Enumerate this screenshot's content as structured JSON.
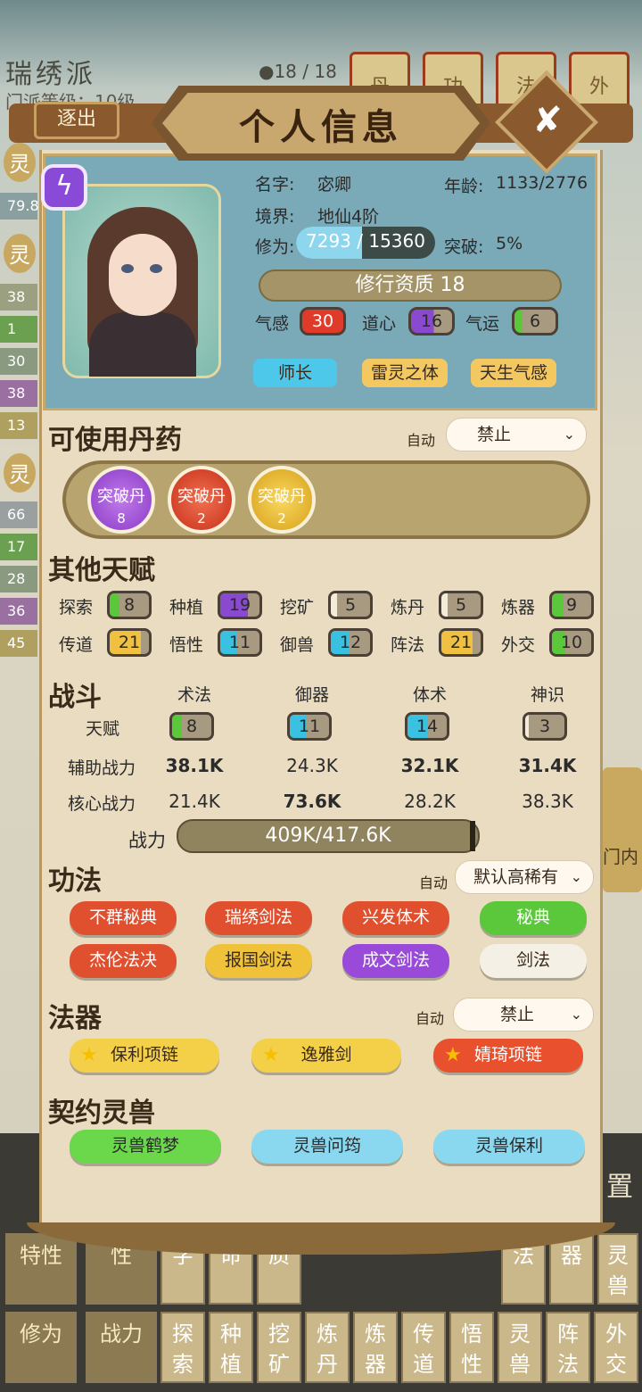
{
  "background": {
    "sect_name": "瑞绣派",
    "sect_level": "门派等级：10级",
    "member_count": "18 / 18",
    "scroll_tabs": [
      "丹",
      "功",
      "法",
      "外"
    ],
    "side_badges": [
      "灵",
      "灵",
      "灵"
    ],
    "side_numbers": [
      "79.8",
      "38",
      "1",
      "30",
      "38",
      "13",
      "66",
      "17",
      "28",
      "36",
      "45"
    ],
    "right_flag_label": "门内",
    "settings_char": "置",
    "grid_row1": [
      "特性",
      "性",
      "字",
      "命",
      "质",
      "",
      "",
      "",
      "",
      "",
      "法",
      "器",
      "灵兽"
    ],
    "grid_row2": [
      "修为",
      "战力",
      "探索",
      "种植",
      "挖矿",
      "炼丹",
      "炼器",
      "传道",
      "悟性",
      "灵兽",
      "阵法",
      "外交"
    ]
  },
  "header": {
    "title": "个人信息",
    "exit_label": "逐出",
    "close_icon": "✘"
  },
  "profile": {
    "name_label": "名字:",
    "name": "宓卿",
    "age_label": "年龄:",
    "age": "1133/2776",
    "realm_label": "境界:",
    "realm": "地仙4阶",
    "cultivation_label": "修为:",
    "cultivation_current": 7293,
    "cultivation_max": 15360,
    "cultivation_text": "7293 / 15360",
    "breakthrough_label": "突破:",
    "breakthrough": "5%",
    "aptitude": "修行资质 18",
    "qigan_label": "气感",
    "qigan": "30",
    "daoxin_label": "道心",
    "daoxin": "16",
    "qiyun_label": "气运",
    "qiyun": "6",
    "tags": [
      "师长",
      "雷灵之体",
      "天生气感"
    ]
  },
  "pills": {
    "title": "可使用丹药",
    "auto_label": "自动",
    "auto_value": "禁止",
    "items": [
      {
        "name": "突破丹",
        "count": "8",
        "color": "#9a4ad0"
      },
      {
        "name": "突破丹",
        "count": "2",
        "color": "#d8401e"
      },
      {
        "name": "突破丹",
        "count": "2",
        "color": "#e8b020"
      }
    ]
  },
  "talents": {
    "title": "其他天赋",
    "items": [
      {
        "label": "探索",
        "value": "8",
        "fill": 0.25,
        "color": "#5ac83a"
      },
      {
        "label": "种植",
        "value": "19",
        "fill": 0.7,
        "color": "#8a4ad0"
      },
      {
        "label": "挖矿",
        "value": "5",
        "fill": 0.15,
        "color": "#f2ecd8"
      },
      {
        "label": "炼丹",
        "value": "5",
        "fill": 0.15,
        "color": "#f2ecd8"
      },
      {
        "label": "炼器",
        "value": "9",
        "fill": 0.3,
        "color": "#5ac83a"
      },
      {
        "label": "传道",
        "value": "21",
        "fill": 0.8,
        "color": "#f0c040"
      },
      {
        "label": "悟性",
        "value": "11",
        "fill": 0.4,
        "color": "#3ac0e0"
      },
      {
        "label": "御兽",
        "value": "12",
        "fill": 0.45,
        "color": "#3ac0e0"
      },
      {
        "label": "阵法",
        "value": "21",
        "fill": 0.8,
        "color": "#f0c040"
      },
      {
        "label": "外交",
        "value": "10",
        "fill": 0.35,
        "color": "#5ac83a"
      }
    ]
  },
  "combat": {
    "title": "战斗",
    "columns": [
      "术法",
      "御器",
      "体术",
      "神识"
    ],
    "talent_label": "天赋",
    "talent_values": [
      {
        "value": "8",
        "fill": 0.25,
        "color": "#5ac83a"
      },
      {
        "value": "11",
        "fill": 0.4,
        "color": "#3ac0e0"
      },
      {
        "value": "14",
        "fill": 0.5,
        "color": "#3ac0e0"
      },
      {
        "value": "3",
        "fill": 0.1,
        "color": "#f2ecd8"
      }
    ],
    "aux_label": "辅助战力",
    "aux_values": [
      "38.1K",
      "24.3K",
      "32.1K",
      "31.4K"
    ],
    "core_label": "核心战力",
    "core_values": [
      "21.4K",
      "73.6K",
      "28.2K",
      "38.3K"
    ],
    "power_label": "战力",
    "power_text": "409K/417.6K",
    "power_current": 409,
    "power_max": 417.6
  },
  "gongfa": {
    "title": "功法",
    "auto_label": "自动",
    "auto_value": "默认高稀有",
    "items": [
      {
        "label": "不群秘典",
        "color": "#e0502e"
      },
      {
        "label": "瑞绣剑法",
        "color": "#e0502e"
      },
      {
        "label": "兴发体术",
        "color": "#e0502e"
      },
      {
        "label": "秘典",
        "color": "#5ac83a"
      },
      {
        "label": "杰伦法决",
        "color": "#e0502e"
      },
      {
        "label": "报国剑法",
        "color": "#f0c23a"
      },
      {
        "label": "成文剑法",
        "color": "#9a4ad8"
      },
      {
        "label": "剑法",
        "color": "#f4f0e6"
      }
    ]
  },
  "faqi": {
    "title": "法器",
    "auto_label": "自动",
    "auto_value": "禁止",
    "items": [
      {
        "label": "保利项链",
        "color": "#f4d048"
      },
      {
        "label": "逸雅剑",
        "color": "#f4d048"
      },
      {
        "label": "婧琦项链",
        "color": "#e8502e"
      }
    ]
  },
  "beasts": {
    "title": "契约灵兽",
    "items": [
      {
        "label": "灵兽鹤梦",
        "color": "#6ad84a"
      },
      {
        "label": "灵兽问筠",
        "color": "#8ad8f0"
      },
      {
        "label": "灵兽保利",
        "color": "#8ad8f0"
      }
    ]
  }
}
